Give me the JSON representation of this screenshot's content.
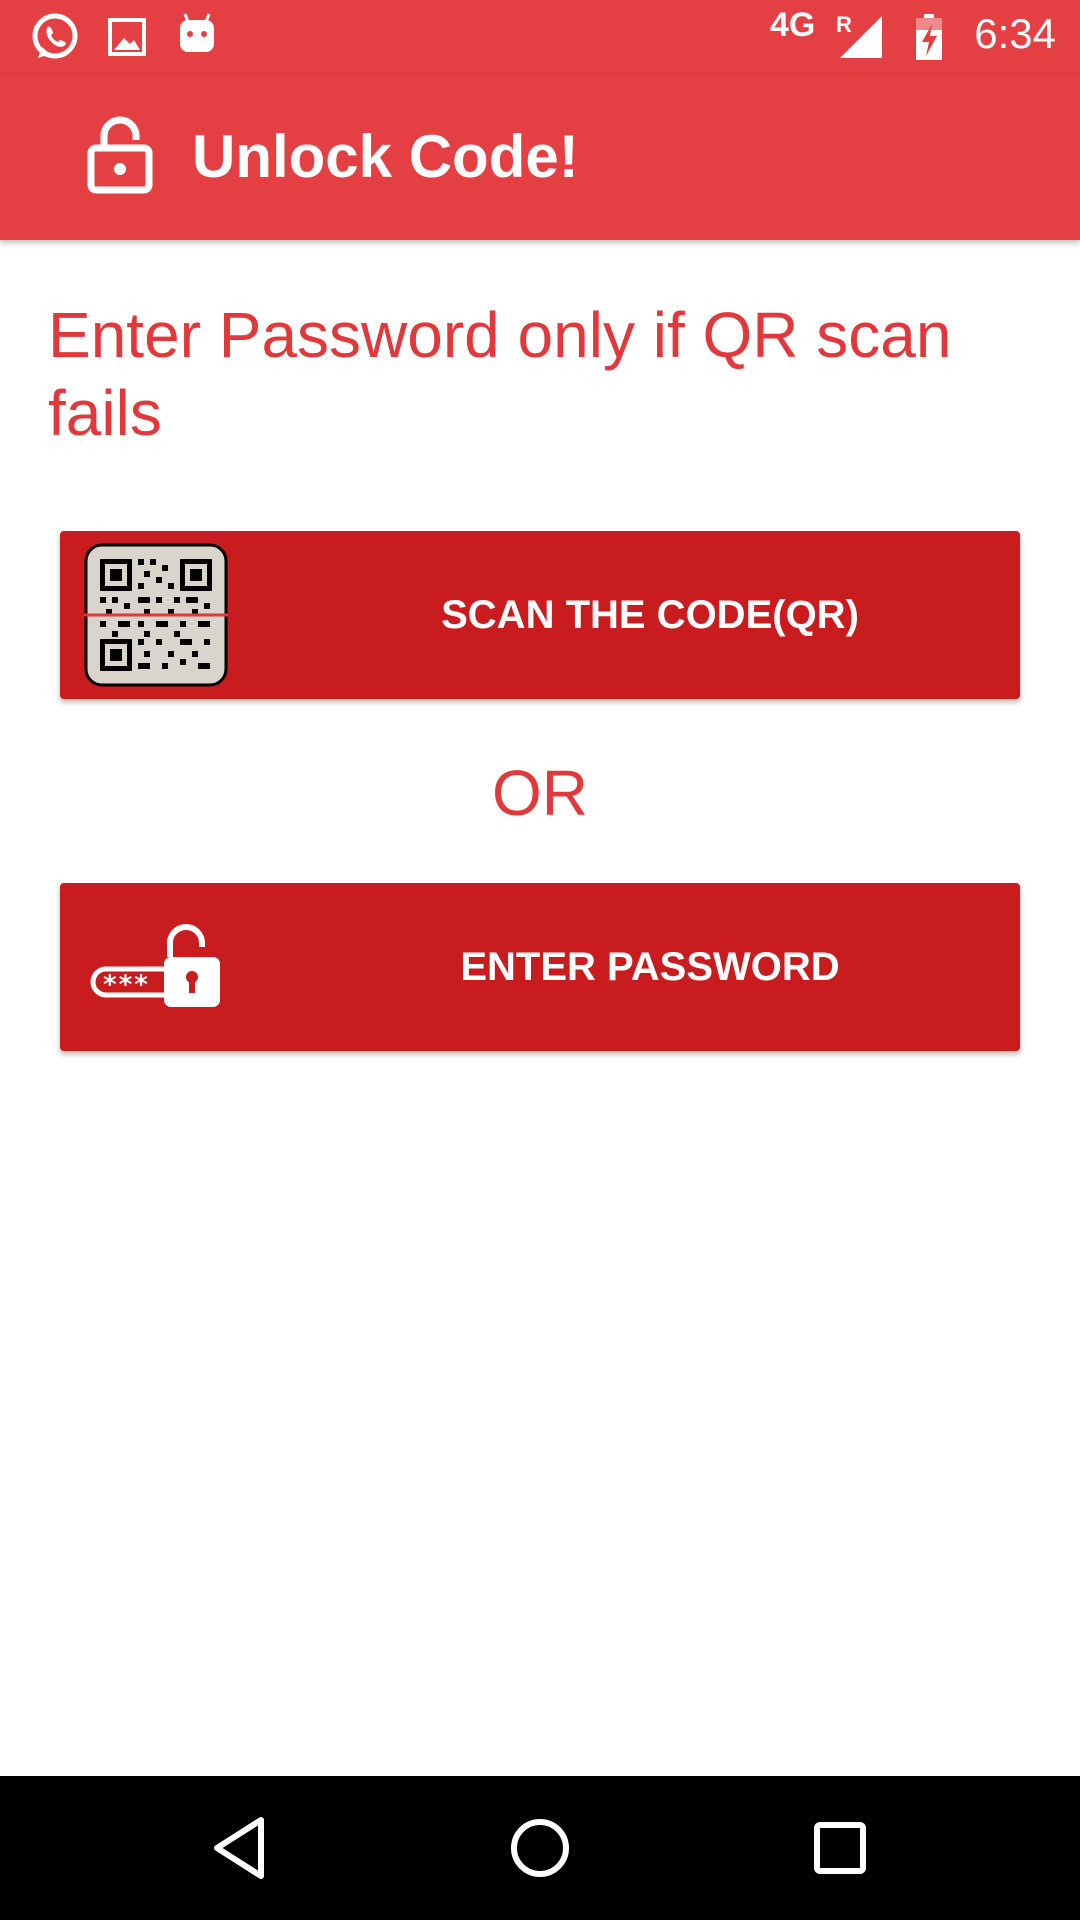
{
  "status_bar": {
    "notification_icons": [
      "whatsapp-icon",
      "image-icon",
      "android-icon"
    ],
    "network": "4G",
    "roaming": "R",
    "signal_icon": "signal-icon",
    "battery_icon": "battery-charging-icon",
    "time": "6:34"
  },
  "app_bar": {
    "icon": "lock-open-icon",
    "title": "Unlock Code!"
  },
  "main": {
    "instruction": "Enter Password only if QR scan fails",
    "scan_button": {
      "icon": "qr-code-icon",
      "label": "SCAN THE CODE(QR)"
    },
    "or_label": "OR",
    "password_button": {
      "icon": "password-lock-icon",
      "label": "ENTER PASSWORD"
    }
  },
  "nav_bar": {
    "back_icon": "back-icon",
    "home_icon": "home-icon",
    "recents_icon": "recents-icon"
  },
  "colors": {
    "primary": "#e44043",
    "button": "#c91c1e",
    "accent_text": "#e0383b",
    "nav_bar": "#000000"
  }
}
